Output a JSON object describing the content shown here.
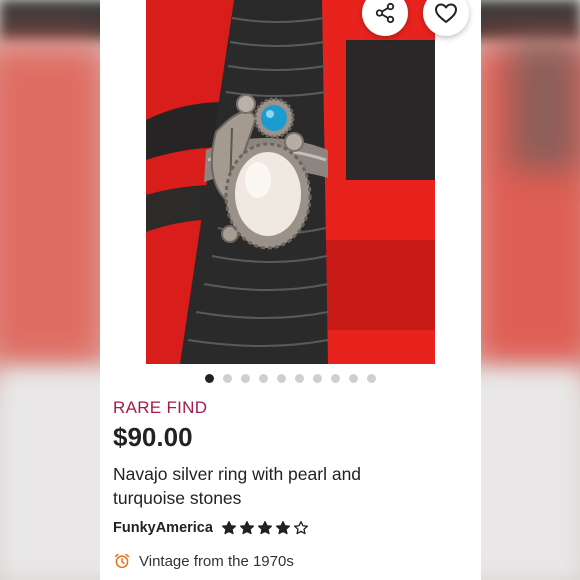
{
  "listing": {
    "badge": "RARE FIND",
    "price": "$90.00",
    "title": "Navajo silver ring with pearl and turquoise stones",
    "shop": "FunkyAmerica",
    "rating": 4,
    "rating_max": 5,
    "meta": "Vintage from the 1970s"
  },
  "carousel": {
    "total": 10,
    "active_index": 0
  },
  "icons": {
    "share": "share-icon",
    "favorite": "heart-icon",
    "clock": "alarm-clock-icon",
    "star": "star-icon"
  },
  "colors": {
    "badge": "#a61a4b",
    "clock": "#e8701a",
    "star": "#222222"
  }
}
